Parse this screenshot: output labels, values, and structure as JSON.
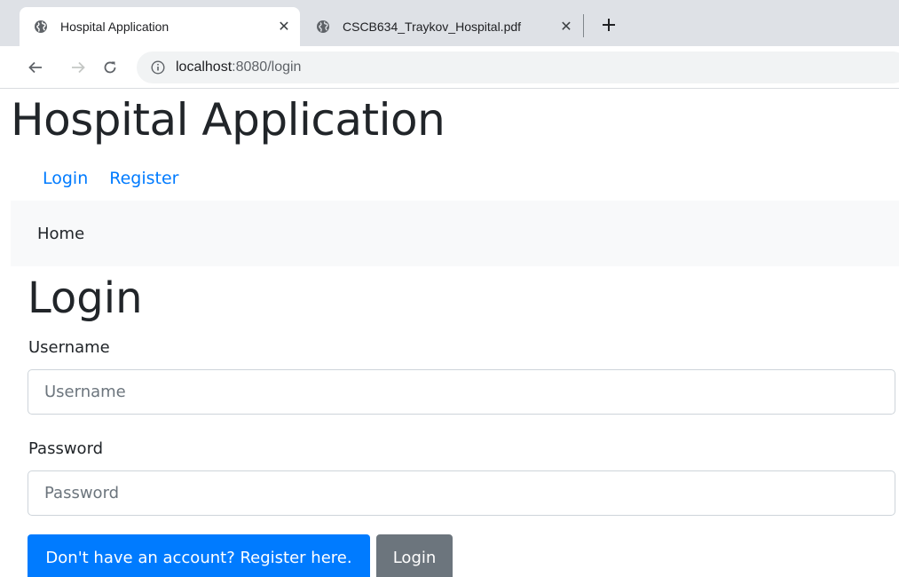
{
  "browser": {
    "tabs": [
      {
        "title": "Hospital Application",
        "icon": "globe-icon",
        "active": true
      },
      {
        "title": "CSCB634_Traykov_Hospital.pdf",
        "icon": "globe-icon",
        "active": false
      }
    ],
    "close_glyph": "✕",
    "new_tab_glyph": "+",
    "address": {
      "host": "localhost",
      "path": ":8080/login"
    }
  },
  "page": {
    "title": "Hospital Application",
    "nav": [
      {
        "label": "Login"
      },
      {
        "label": "Register"
      }
    ],
    "breadcrumb": "Home"
  },
  "form": {
    "title": "Login",
    "username": {
      "label": "Username",
      "placeholder": "Username",
      "value": ""
    },
    "password": {
      "label": "Password",
      "placeholder": "Password",
      "value": ""
    },
    "register_button": "Don't have an account? Register here.",
    "login_button": "Login"
  },
  "colors": {
    "link": "#007bff",
    "primary_button": "#007bff",
    "secondary_button": "#6c757d",
    "breadcrumb_bg": "#f8f9fa"
  }
}
